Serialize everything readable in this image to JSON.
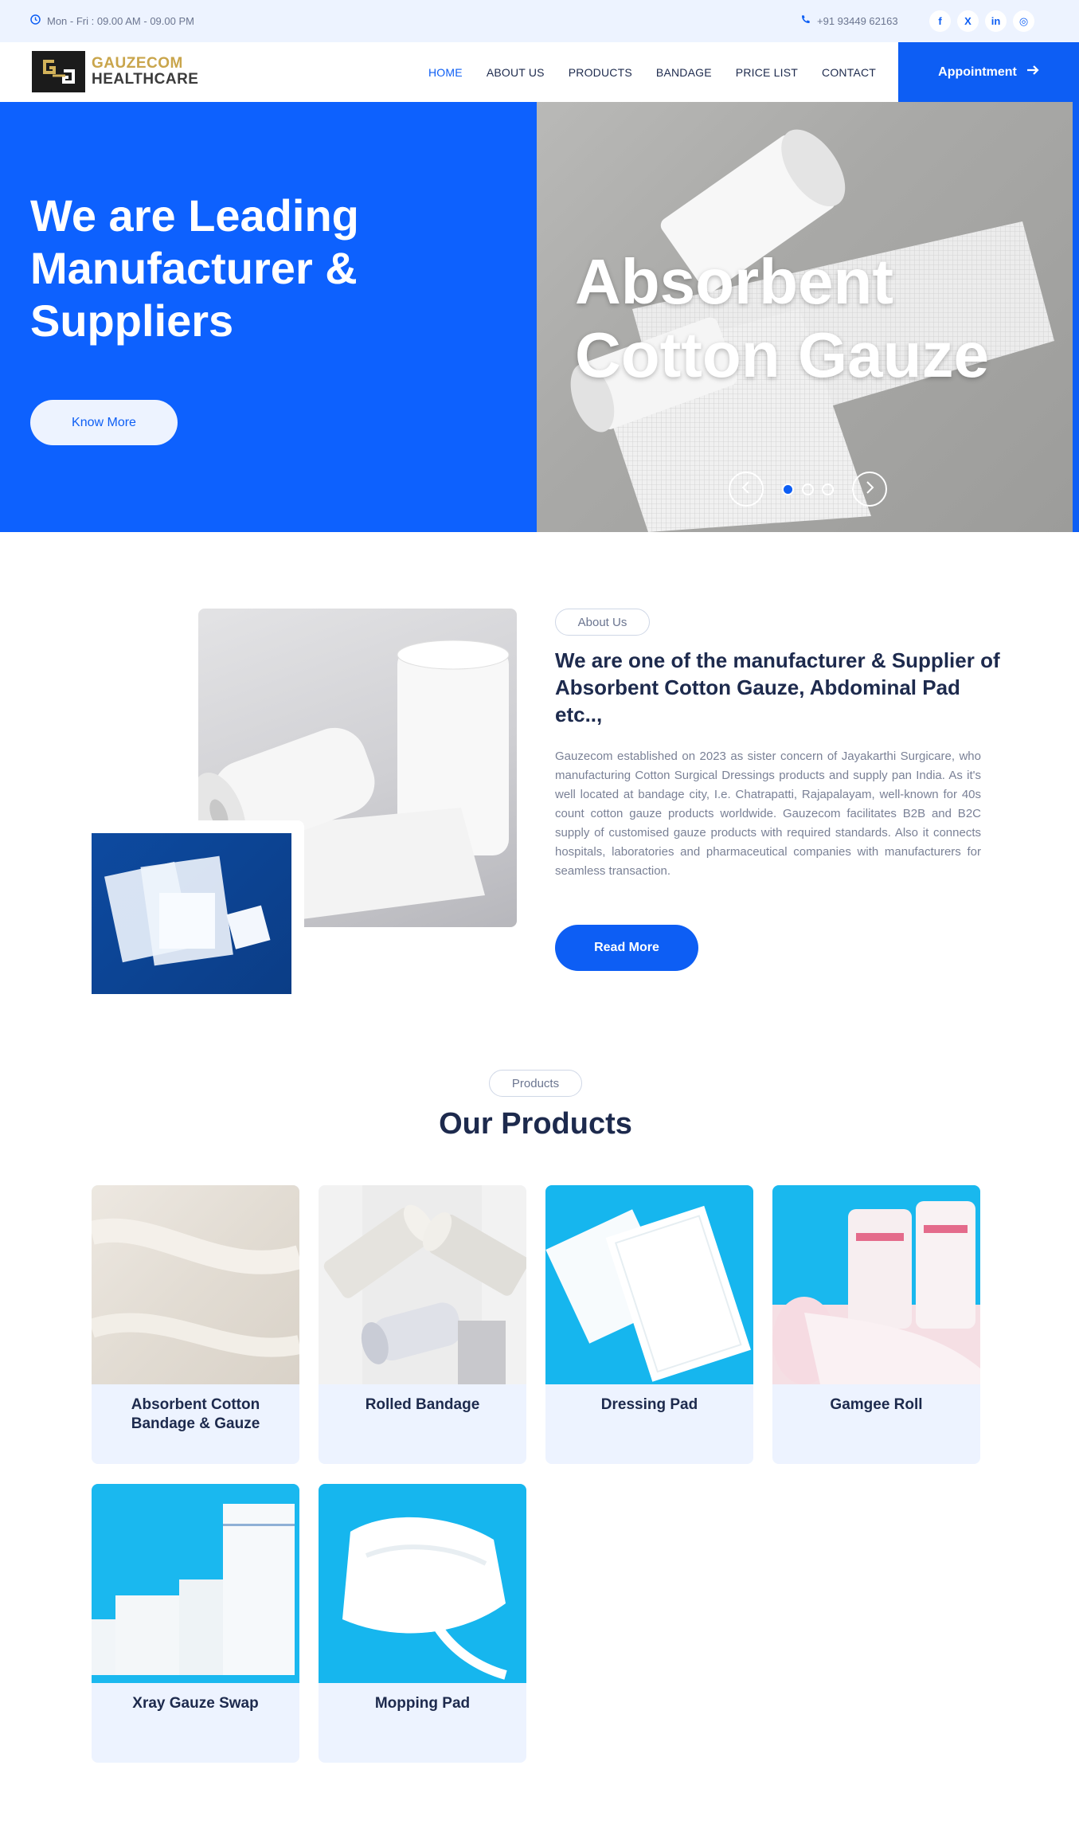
{
  "topbar": {
    "hours": "Mon - Fri : 09.00 AM - 09.00 PM",
    "phone": "+91 93449 62163",
    "socials": [
      "f",
      "X",
      "in",
      "◎"
    ]
  },
  "brand": {
    "line1": "GAUZECOM",
    "line2": "HEALTHCARE"
  },
  "nav": {
    "items": [
      "HOME",
      "ABOUT US",
      "PRODUCTS",
      "BANDAGE",
      "PRICE LIST",
      "CONTACT"
    ],
    "active": "HOME",
    "appointment": "Appointment"
  },
  "hero": {
    "title": "We are Leading Manufacturer & Suppliers",
    "button": "Know More",
    "slide_title": "Absorbent Cotton Gauze",
    "slide_count": 3,
    "active_slide": 1
  },
  "about": {
    "pill": "About Us",
    "heading": "We are one of the manufacturer & Supplier of Absorbent Cotton Gauze, Abdominal Pad etc..,",
    "paragraph": "Gauzecom established on 2023 as sister concern of Jayakarthi Surgicare, who manufacturing Cotton Surgical Dressings products and supply pan India. As it's well located at bandage city, I.e. Chatrapatti, Rajapalayam, well-known for 40s count cotton gauze products worldwide. Gauzecom facilitates B2B and B2C supply of customised gauze products with required standards. Also it connects hospitals, laboratories and pharmaceutical companies with manufacturers for seamless transaction.",
    "button": "Read More"
  },
  "products": {
    "pill": "Products",
    "title": "Our Products",
    "items": [
      {
        "name": "Absorbent Cotton Bandage & Gauze"
      },
      {
        "name": "Rolled Bandage"
      },
      {
        "name": "Dressing Pad"
      },
      {
        "name": "Gamgee Roll"
      },
      {
        "name": "Xray Gauze Swap"
      },
      {
        "name": "Mopping Pad"
      }
    ]
  },
  "colors": {
    "accent": "#0d5ef4",
    "heading": "#1d2a4d",
    "light_bg": "#edf3ff",
    "hero_blue": "#0d61fe"
  }
}
